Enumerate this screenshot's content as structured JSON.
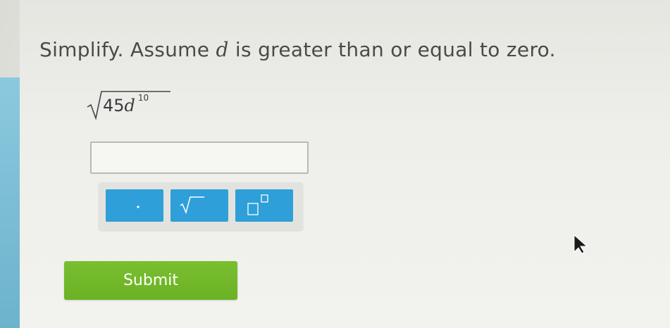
{
  "question": {
    "prefix": "Simplify. Assume ",
    "variable": "d",
    "suffix": " is greater than or equal to zero."
  },
  "expression": {
    "coefficient": "45",
    "variable": "d",
    "exponent": "10"
  },
  "answer": {
    "value": ""
  },
  "toolbar": {
    "buttons": [
      {
        "icon": "multiply-dot-icon"
      },
      {
        "icon": "square-root-icon"
      },
      {
        "icon": "exponent-icon"
      }
    ]
  },
  "submit": {
    "label": "Submit"
  },
  "colors": {
    "tool_button": "#2e9fd8",
    "submit": "#74b82b",
    "left_strip": "#7dbfd6"
  }
}
